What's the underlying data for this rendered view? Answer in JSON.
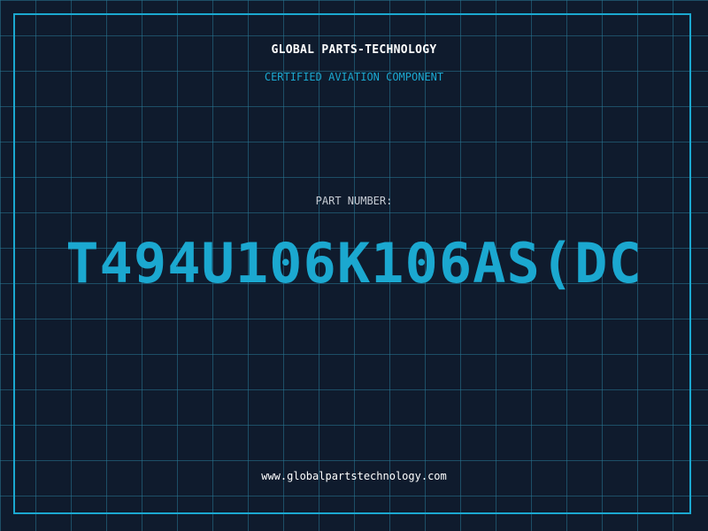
{
  "header": {
    "company_name": "GLOBAL PARTS-TECHNOLOGY",
    "tagline": "CERTIFIED AVIATION COMPONENT"
  },
  "part": {
    "label": "PART NUMBER:",
    "number": "T494U106K106AS(DC"
  },
  "footer": {
    "website": "www.globalpartstechnology.com"
  },
  "colors": {
    "background": "#0f1b2d",
    "accent": "#1ba8d0",
    "text": "#ffffff",
    "muted_text": "#c7ccd4"
  }
}
